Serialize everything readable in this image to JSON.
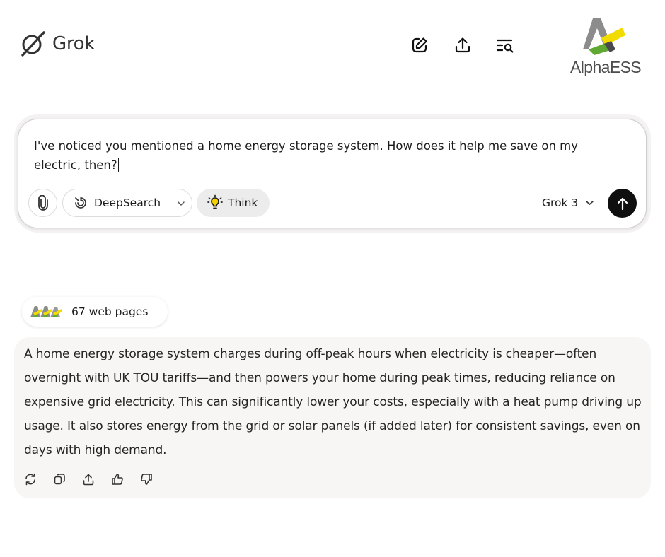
{
  "app": {
    "name": "Grok"
  },
  "header": {
    "icons": [
      "new-chat-icon",
      "share-icon",
      "history-search-icon"
    ],
    "brand_text": "AlphaESS"
  },
  "composer": {
    "prompt": "I've noticed you mentioned a home energy storage system. How does it help me save on my electric, then?",
    "deepsearch_label": "DeepSearch",
    "think_label": "Think",
    "model_label": "Grok 3"
  },
  "sources": {
    "label": "67 web pages"
  },
  "answer": {
    "text": "A home energy storage system charges during off-peak hours when electricity is cheaper—often overnight with UK TOU tariffs—and then powers your home during peak times, reducing reliance on expensive grid electricity. This can significantly lower your costs, especially with a heat pump driving up usage. It also stores energy from the grid or solar panels (if added later) for consistent savings, even on days with high demand."
  },
  "colors": {
    "send_button": "#0f0f0f",
    "answer_bg": "#f7f6f5",
    "brand_green": "#5fa832",
    "brand_yellow": "#f2dc00"
  }
}
